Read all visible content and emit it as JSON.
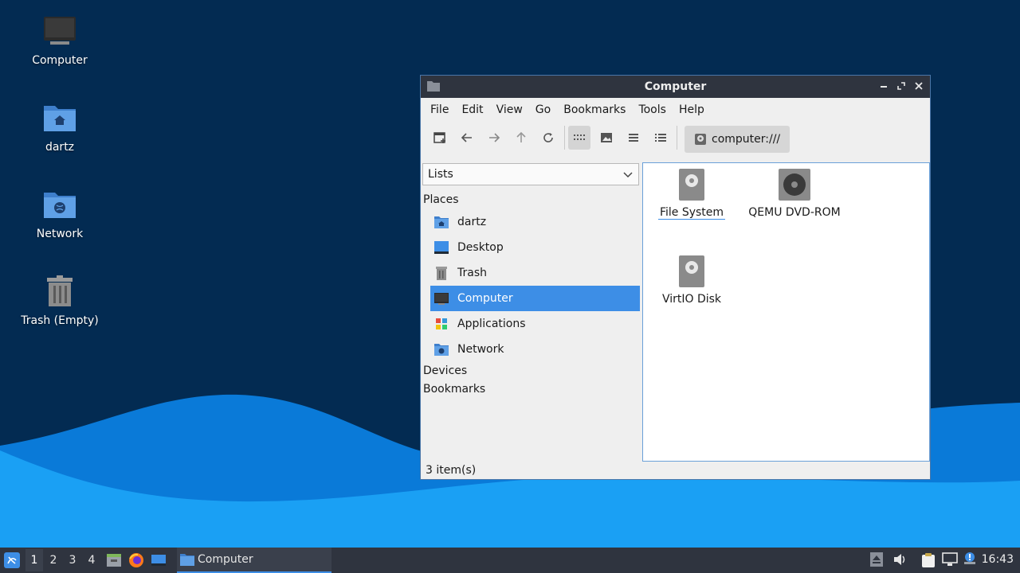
{
  "desktop": {
    "icons": [
      {
        "label": "Computer",
        "icon": "computer-icon"
      },
      {
        "label": "dartz",
        "icon": "home-folder-icon"
      },
      {
        "label": "Network",
        "icon": "network-folder-icon"
      },
      {
        "label": "Trash (Empty)",
        "icon": "trash-icon"
      }
    ]
  },
  "window": {
    "title": "Computer",
    "menu": [
      "File",
      "Edit",
      "View",
      "Go",
      "Bookmarks",
      "Tools",
      "Help"
    ],
    "location": "computer:///",
    "side_pane": {
      "mode": "Lists",
      "sections": {
        "places": "Places",
        "devices": "Devices",
        "bookmarks": "Bookmarks"
      },
      "places": [
        {
          "label": "dartz",
          "icon": "home-folder-icon"
        },
        {
          "label": "Desktop",
          "icon": "desktop-icon"
        },
        {
          "label": "Trash",
          "icon": "trash-icon"
        },
        {
          "label": "Computer",
          "icon": "computer-icon",
          "selected": true
        },
        {
          "label": "Applications",
          "icon": "applications-icon"
        },
        {
          "label": "Network",
          "icon": "network-folder-icon"
        }
      ]
    },
    "items": [
      {
        "label": "File System",
        "icon": "harddisk-icon"
      },
      {
        "label": "QEMU DVD-ROM",
        "icon": "optical-drive-icon"
      },
      {
        "label": "VirtIO Disk",
        "icon": "harddisk-icon"
      }
    ],
    "status": "3 item(s)"
  },
  "taskbar": {
    "workspaces": [
      "1",
      "2",
      "3",
      "4"
    ],
    "task": "Computer",
    "clock": "16:43"
  },
  "colors": {
    "accent": "#3d8ee6",
    "titlebar": "#2f343f",
    "desktop": "#032b52"
  }
}
